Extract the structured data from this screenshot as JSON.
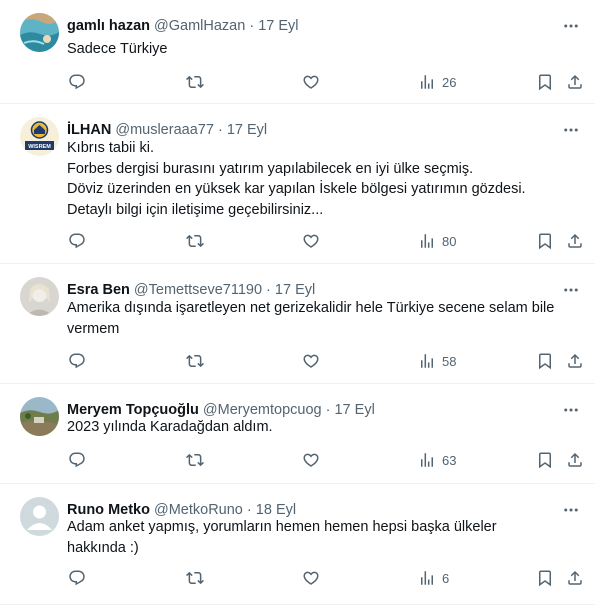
{
  "tweets": [
    {
      "name": "gamlı hazan",
      "handle": "@GamlHazan",
      "time": "17 Eyl",
      "lines": [
        "Sadece Türkiye"
      ],
      "views": "26",
      "avatar": "sea-photo"
    },
    {
      "name": "İLHAN",
      "handle": "@musleraaa77",
      "time": "17 Eyl",
      "lines": [
        "Kıbrıs tabii ki.",
        "Forbes dergisi burasını yatırım yapılabilecek en iyi ülke seçmiş.",
        "Döviz üzerinden en yüksek kar yapılan İskele bölgesi yatırımın gözdesi.",
        "Detaylı bilgi için iletişime geçebilirsiniz..."
      ],
      "views": "80",
      "avatar": "logo",
      "avatar_text": "WISREM"
    },
    {
      "name": "Esra Ben",
      "handle": "@Temettseve71190",
      "time": "17 Eyl",
      "lines": [
        "Amerika dışında işaretleyen net gerizekalidir hele Türkiye secene selam bile",
        "vermem"
      ],
      "views": "58",
      "avatar": "portrait"
    },
    {
      "name": "Meryem Topçuoğlu",
      "handle": "@Meryemtopcuog",
      "time": "17 Eyl",
      "lines": [
        "2023 yılında Karadağdan aldım."
      ],
      "views": "63",
      "avatar": "landscape"
    },
    {
      "name": "Runo Metko",
      "handle": "@MetkoRuno",
      "time": "18 Eyl",
      "lines": [
        "Adam anket yapmış, yorumların hemen hemen hepsi başka ülkeler",
        "hakkında :)"
      ],
      "views": "6",
      "avatar": "default"
    }
  ],
  "colors": {
    "text": "#0f1419",
    "secondary": "#536471",
    "divider": "#eff3f4"
  },
  "icons": [
    "more-icon",
    "reply-icon",
    "retweet-icon",
    "like-icon",
    "views-icon",
    "bookmark-icon",
    "share-icon"
  ]
}
